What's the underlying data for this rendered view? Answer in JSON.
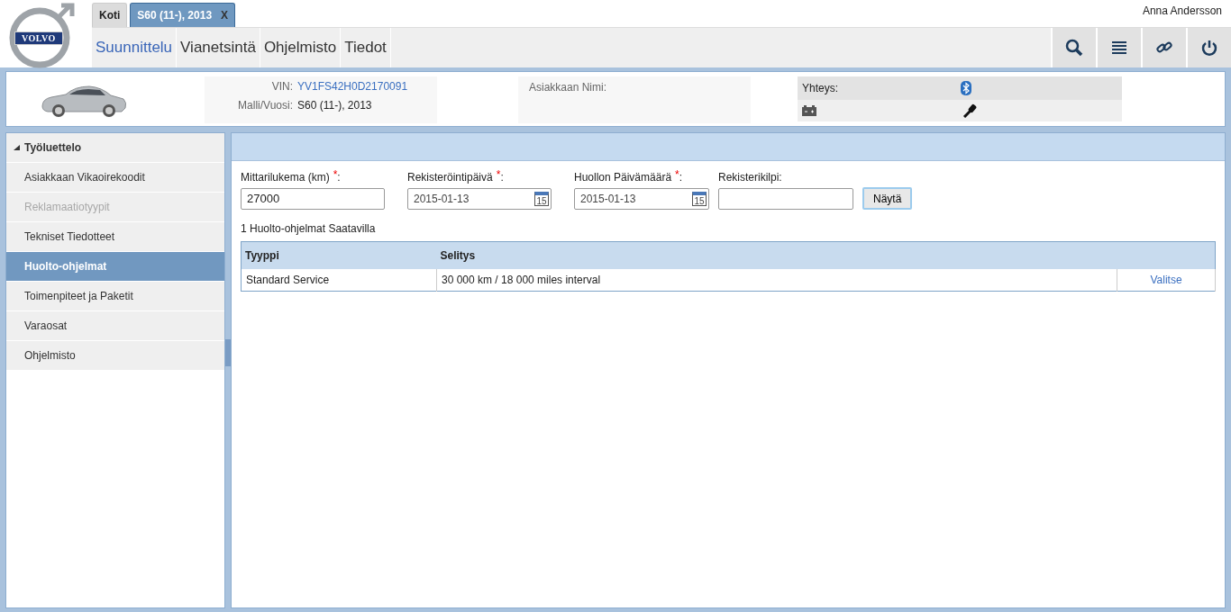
{
  "logo": {
    "text": "VOLVO"
  },
  "tabs": [
    {
      "label": "Koti",
      "selected": false,
      "closable": false
    },
    {
      "label": "S60 (11-), 2013",
      "selected": true,
      "closable": true,
      "close_label": "X"
    }
  ],
  "user": {
    "name": "Anna Andersson"
  },
  "nav": [
    {
      "label": "Suunnittelu",
      "selected": true
    },
    {
      "label": "Vianetsintä",
      "selected": false
    },
    {
      "label": "Ohjelmisto",
      "selected": false
    },
    {
      "label": "Tiedot",
      "selected": false
    }
  ],
  "toolbar": [
    {
      "kind": "search"
    },
    {
      "kind": "list"
    },
    {
      "kind": "link"
    },
    {
      "kind": "power"
    }
  ],
  "vehicle": {
    "vin_label": "VIN:",
    "vin": "YV1FS42H0D2170091",
    "model_label": "Malli/Vuosi:",
    "model": "S60 (11-), 2013",
    "customer_label": "Asiakkaan Nimi:",
    "connection_label": "Yhteys:"
  },
  "sidebar": {
    "title": "Työluettelo",
    "items": [
      {
        "label": "Asiakkaan Vikaoirekoodit",
        "selected": false,
        "disabled": false
      },
      {
        "label": "Reklamaatiotyypit",
        "selected": false,
        "disabled": true
      },
      {
        "label": "Tekniset Tiedotteet",
        "selected": false,
        "disabled": false
      },
      {
        "label": "Huolto-ohjelmat",
        "selected": true,
        "disabled": false
      },
      {
        "label": "Toimenpiteet ja Paketit",
        "selected": false,
        "disabled": false
      },
      {
        "label": "Varaosat",
        "selected": false,
        "disabled": false
      },
      {
        "label": "Ohjelmisto",
        "selected": false,
        "disabled": false
      }
    ]
  },
  "form": {
    "fields": [
      {
        "kind": "text",
        "label": "Mittarilukema (km)",
        "required": true,
        "required_mark": "*",
        "label_suffix": ":",
        "value": "27000"
      },
      {
        "kind": "date",
        "label": "Rekisteröintipäivä",
        "required": true,
        "required_mark": "*",
        "label_suffix": ":",
        "value": "2015-01-13",
        "calendar_day": "15"
      },
      {
        "kind": "date",
        "label": "Huollon Päivämäärä",
        "required": true,
        "required_mark": "*",
        "label_suffix": ":",
        "value": "2015-01-13",
        "calendar_day": "15"
      },
      {
        "kind": "text",
        "label": "Rekisterikilpi:",
        "required": false
      }
    ],
    "button": "Näytä"
  },
  "results": {
    "summary": "1 Huolto-ohjelmat Saatavilla",
    "columns": [
      "Tyyppi",
      "Selitys"
    ],
    "rows": [
      {
        "type": "Standard Service",
        "description": "30 000 km / 18 000 miles interval",
        "action": "Valitse"
      }
    ]
  }
}
